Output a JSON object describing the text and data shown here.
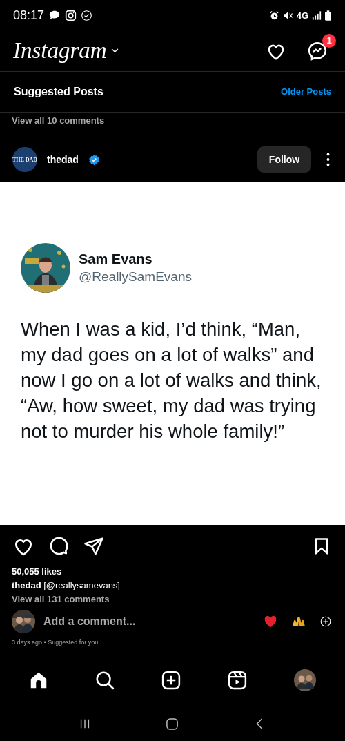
{
  "status_bar": {
    "time": "08:17",
    "network": "4G"
  },
  "header": {
    "logo": "Instagram",
    "messages_badge": "1"
  },
  "feed_header": {
    "title": "Suggested Posts",
    "link": "Older Posts"
  },
  "previous_post": {
    "comments_link": "View all 10 comments"
  },
  "post": {
    "avatar_label": "THE DAD",
    "username": "thedad",
    "verified": true,
    "follow_button": "Follow",
    "tweet": {
      "name": "Sam Evans",
      "handle": "@ReallySamEvans",
      "text": "When I was a kid, I’d think, “Man, my dad goes on a lot of walks” and now I go on a lot of walks and think, “Aw, how sweet, my dad was trying not to murder his whole family!”"
    },
    "likes": "50,055 likes",
    "caption_user": "thedad",
    "caption": "[@reallysamevans]",
    "comments_link": "View all 131 comments",
    "comment_placeholder": "Add a comment...",
    "meta": "3 days ago • Suggested for you"
  },
  "bottom_nav": [
    {
      "kind": "home",
      "selected": true
    },
    {
      "kind": "search",
      "selected": false
    },
    {
      "kind": "create",
      "selected": false
    },
    {
      "kind": "reels",
      "selected": false
    },
    {
      "kind": "profile",
      "selected": false
    }
  ]
}
